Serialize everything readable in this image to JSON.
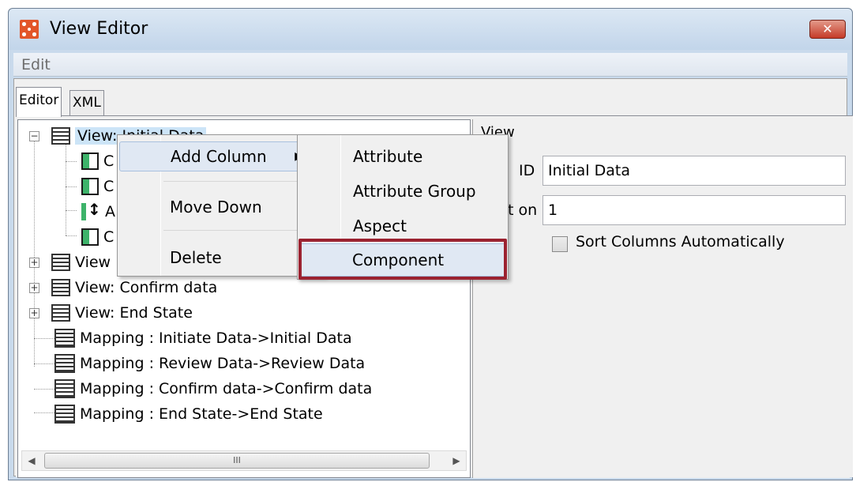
{
  "window": {
    "title": "View Editor",
    "close_label": "✕"
  },
  "menubar": {
    "edit_label": "Edit"
  },
  "tabs": [
    {
      "label": "Editor"
    },
    {
      "label": "XML"
    }
  ],
  "tree": {
    "items": [
      {
        "label": "View: Initial Data",
        "type": "view",
        "expanded": true,
        "selected": true
      },
      {
        "label": "C",
        "type": "column"
      },
      {
        "label": "C",
        "type": "column"
      },
      {
        "label": "A",
        "type": "attribute"
      },
      {
        "label": "C",
        "type": "column"
      },
      {
        "label": "View",
        "type": "view"
      },
      {
        "label": "View: Confirm data",
        "type": "view"
      },
      {
        "label": "View: End State",
        "type": "view"
      },
      {
        "label": "Mapping : Initiate Data->Initial Data",
        "type": "mapping"
      },
      {
        "label": "Mapping : Review Data->Review Data",
        "type": "mapping"
      },
      {
        "label": "Mapping : Confirm data->Confirm data",
        "type": "mapping"
      },
      {
        "label": "Mapping : End State->End State",
        "type": "mapping"
      }
    ],
    "scroll_thumb_label": "III"
  },
  "right_panel": {
    "title": "View",
    "id_label": "ID",
    "id_value": "Initial Data",
    "sort_label": "t on",
    "sort_value": "1",
    "auto_sort_label": "Sort Columns Automatically",
    "auto_sort_checked": false
  },
  "context_menu": {
    "items": [
      {
        "label": "Add Column",
        "has_submenu": true
      },
      {
        "label": "Move Down"
      },
      {
        "label": "Delete"
      }
    ]
  },
  "submenu": {
    "items": [
      {
        "label": "Attribute"
      },
      {
        "label": "Attribute Group"
      },
      {
        "label": "Aspect"
      },
      {
        "label": "Component",
        "highlighted": true
      }
    ]
  },
  "colors": {
    "highlight_box": "#9b2230",
    "selection": "#cce4f7",
    "close_button": "#c53b28"
  }
}
